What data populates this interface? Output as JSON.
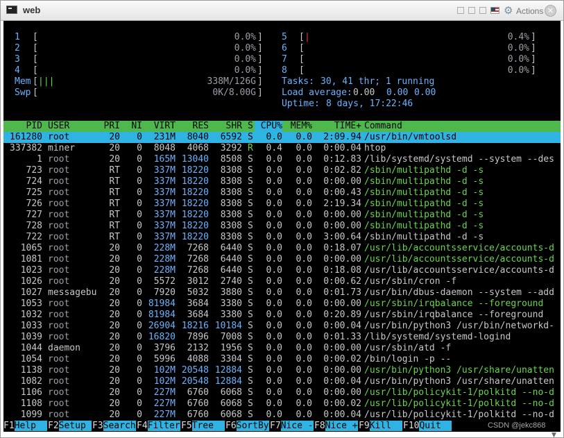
{
  "window": {
    "title": "web",
    "actions_label": "Actions",
    "close_glyph": "✕",
    "icons": [
      "terminal-icon",
      "restore-icon",
      "minimize-icon",
      "maximize-icon",
      "us-flag-icon",
      "gear-icon",
      "close-icon"
    ]
  },
  "meters": {
    "cpus_left": [
      {
        "num": "1",
        "open": "[",
        "bar": "",
        "value": "0.0%",
        "close": "]"
      },
      {
        "num": "2",
        "open": "[",
        "bar": "",
        "value": "0.0%",
        "close": "]"
      },
      {
        "num": "3",
        "open": "[",
        "bar": "",
        "value": "0.0%",
        "close": "]"
      },
      {
        "num": "4",
        "open": "[",
        "bar": "",
        "value": "0.0%",
        "close": "]"
      }
    ],
    "cpus_right": [
      {
        "num": "5",
        "open": "[",
        "bar": "|",
        "value": "0.4%",
        "close": "]"
      },
      {
        "num": "6",
        "open": "[",
        "bar": "",
        "value": "0.0%",
        "close": "]"
      },
      {
        "num": "7",
        "open": "[",
        "bar": "",
        "value": "0.0%",
        "close": "]"
      },
      {
        "num": "8",
        "open": "[",
        "bar": "",
        "value": "0.0%",
        "close": "]"
      }
    ],
    "mem": {
      "label": "Mem",
      "open": "[",
      "bar": "|||",
      "value": "338M/126G",
      "close": "]"
    },
    "swp": {
      "label": "Swp",
      "open": "[",
      "bar": "",
      "value": "0K/8.00G",
      "close": "]"
    },
    "tasks": {
      "label": "Tasks:",
      "value": "30, 41 thr; 1 running"
    },
    "load": {
      "label": "Load average:",
      "v1": "0.00",
      "v2": "0.00",
      "v3": "0.00"
    },
    "uptime": {
      "label": "Uptime:",
      "value": "8 days, 17:22:46"
    }
  },
  "table": {
    "columns": [
      "PID",
      "USER",
      "PRI",
      "NI",
      "VIRT",
      "RES",
      "SHR",
      "S",
      "CPU%",
      "MEM%",
      "TIME+",
      "Command"
    ],
    "rows": [
      {
        "pid": "161280",
        "user": "root",
        "pri": "20",
        "ni": "0",
        "virt": "231M",
        "res": "8040",
        "shr": "6592",
        "s": "S",
        "cpu": "0.0",
        "mem": "0.0",
        "time": "2:09.94",
        "cmd": "/usr/bin/vmtoolsd",
        "thread": false
      },
      {
        "pid": "337382",
        "user": "miner",
        "pri": "20",
        "ni": "0",
        "virt": "8048",
        "res": "4068",
        "shr": "3292",
        "s": "R",
        "cpu": "0.4",
        "mem": "0.0",
        "time": "0:00.04",
        "cmd": "htop",
        "thread": false
      },
      {
        "pid": "1",
        "user": "root",
        "pri": "20",
        "ni": "0",
        "virt": "165M",
        "res": "13040",
        "shr": "8508",
        "s": "S",
        "cpu": "0.0",
        "mem": "0.0",
        "time": "0:12.83",
        "cmd": "/lib/systemd/systemd --system --des",
        "thread": false
      },
      {
        "pid": "723",
        "user": "root",
        "pri": "RT",
        "ni": "0",
        "virt": "337M",
        "res": "18220",
        "shr": "8308",
        "s": "S",
        "cpu": "0.0",
        "mem": "0.0",
        "time": "0:02.82",
        "cmd": "/sbin/multipathd -d -s",
        "thread": true
      },
      {
        "pid": "724",
        "user": "root",
        "pri": "RT",
        "ni": "0",
        "virt": "337M",
        "res": "18220",
        "shr": "8308",
        "s": "S",
        "cpu": "0.0",
        "mem": "0.0",
        "time": "0:00.00",
        "cmd": "/sbin/multipathd -d -s",
        "thread": true
      },
      {
        "pid": "725",
        "user": "root",
        "pri": "RT",
        "ni": "0",
        "virt": "337M",
        "res": "18220",
        "shr": "8308",
        "s": "S",
        "cpu": "0.0",
        "mem": "0.0",
        "time": "0:00.43",
        "cmd": "/sbin/multipathd -d -s",
        "thread": true
      },
      {
        "pid": "726",
        "user": "root",
        "pri": "RT",
        "ni": "0",
        "virt": "337M",
        "res": "18220",
        "shr": "8308",
        "s": "S",
        "cpu": "0.0",
        "mem": "0.0",
        "time": "2:19.34",
        "cmd": "/sbin/multipathd -d -s",
        "thread": true
      },
      {
        "pid": "727",
        "user": "root",
        "pri": "RT",
        "ni": "0",
        "virt": "337M",
        "res": "18220",
        "shr": "8308",
        "s": "S",
        "cpu": "0.0",
        "mem": "0.0",
        "time": "0:00.00",
        "cmd": "/sbin/multipathd -d -s",
        "thread": true
      },
      {
        "pid": "728",
        "user": "root",
        "pri": "RT",
        "ni": "0",
        "virt": "337M",
        "res": "18220",
        "shr": "8308",
        "s": "S",
        "cpu": "0.0",
        "mem": "0.0",
        "time": "0:00.00",
        "cmd": "/sbin/multipathd -d -s",
        "thread": true
      },
      {
        "pid": "722",
        "user": "root",
        "pri": "RT",
        "ni": "0",
        "virt": "337M",
        "res": "18220",
        "shr": "8308",
        "s": "S",
        "cpu": "0.0",
        "mem": "0.0",
        "time": "3:00.64",
        "cmd": "/sbin/multipathd -d -s",
        "thread": false
      },
      {
        "pid": "1065",
        "user": "root",
        "pri": "20",
        "ni": "0",
        "virt": "228M",
        "res": "7268",
        "shr": "6440",
        "s": "S",
        "cpu": "0.0",
        "mem": "0.0",
        "time": "0:18.07",
        "cmd": "/usr/lib/accountsservice/accounts-d",
        "thread": true
      },
      {
        "pid": "1081",
        "user": "root",
        "pri": "20",
        "ni": "0",
        "virt": "228M",
        "res": "7268",
        "shr": "6440",
        "s": "S",
        "cpu": "0.0",
        "mem": "0.0",
        "time": "0:00.00",
        "cmd": "/usr/lib/accountsservice/accounts-d",
        "thread": true
      },
      {
        "pid": "1023",
        "user": "root",
        "pri": "20",
        "ni": "0",
        "virt": "228M",
        "res": "7268",
        "shr": "6440",
        "s": "S",
        "cpu": "0.0",
        "mem": "0.0",
        "time": "0:18.08",
        "cmd": "/usr/lib/accountsservice/accounts-d",
        "thread": false
      },
      {
        "pid": "1026",
        "user": "root",
        "pri": "20",
        "ni": "0",
        "virt": "5572",
        "res": "3012",
        "shr": "2740",
        "s": "S",
        "cpu": "0.0",
        "mem": "0.0",
        "time": "0:00.62",
        "cmd": "/usr/sbin/cron -f",
        "thread": false
      },
      {
        "pid": "1027",
        "user": "messagebu",
        "pri": "20",
        "ni": "0",
        "virt": "7920",
        "res": "5032",
        "shr": "3880",
        "s": "S",
        "cpu": "0.0",
        "mem": "0.0",
        "time": "0:01.73",
        "cmd": "/usr/bin/dbus-daemon --system --add",
        "thread": false
      },
      {
        "pid": "1053",
        "user": "root",
        "pri": "20",
        "ni": "0",
        "virt": "81984",
        "res": "3684",
        "shr": "3380",
        "s": "S",
        "cpu": "0.0",
        "mem": "0.0",
        "time": "0:00.00",
        "cmd": "/usr/sbin/irqbalance --foreground",
        "thread": true
      },
      {
        "pid": "1032",
        "user": "root",
        "pri": "20",
        "ni": "0",
        "virt": "81984",
        "res": "3684",
        "shr": "3380",
        "s": "S",
        "cpu": "0.0",
        "mem": "0.0",
        "time": "0:20.89",
        "cmd": "/usr/sbin/irqbalance --foreground",
        "thread": false
      },
      {
        "pid": "1033",
        "user": "root",
        "pri": "20",
        "ni": "0",
        "virt": "26904",
        "res": "18216",
        "shr": "10184",
        "s": "S",
        "cpu": "0.0",
        "mem": "0.0",
        "time": "0:00.04",
        "cmd": "/usr/bin/python3 /usr/bin/networkd-",
        "thread": false
      },
      {
        "pid": "1039",
        "user": "root",
        "pri": "20",
        "ni": "0",
        "virt": "16820",
        "res": "7896",
        "shr": "7008",
        "s": "S",
        "cpu": "0.0",
        "mem": "0.0",
        "time": "0:01.33",
        "cmd": "/lib/systemd/systemd-logind",
        "thread": false
      },
      {
        "pid": "1044",
        "user": "daemon",
        "pri": "20",
        "ni": "0",
        "virt": "3796",
        "res": "2132",
        "shr": "1956",
        "s": "S",
        "cpu": "0.0",
        "mem": "0.0",
        "time": "0:00.00",
        "cmd": "/usr/sbin/atd -f",
        "thread": false
      },
      {
        "pid": "1054",
        "user": "root",
        "pri": "20",
        "ni": "0",
        "virt": "5996",
        "res": "4088",
        "shr": "3304",
        "s": "S",
        "cpu": "0.0",
        "mem": "0.0",
        "time": "0:00.02",
        "cmd": "/bin/login -p --",
        "thread": false
      },
      {
        "pid": "1138",
        "user": "root",
        "pri": "20",
        "ni": "0",
        "virt": "102M",
        "res": "20548",
        "shr": "12884",
        "s": "S",
        "cpu": "0.0",
        "mem": "0.0",
        "time": "0:00.00",
        "cmd": "/usr/bin/python3 /usr/share/unatten",
        "thread": true
      },
      {
        "pid": "1082",
        "user": "root",
        "pri": "20",
        "ni": "0",
        "virt": "102M",
        "res": "20548",
        "shr": "12884",
        "s": "S",
        "cpu": "0.0",
        "mem": "0.0",
        "time": "0:00.04",
        "cmd": "/usr/bin/python3 /usr/share/unatten",
        "thread": false
      },
      {
        "pid": "1106",
        "user": "root",
        "pri": "20",
        "ni": "0",
        "virt": "227M",
        "res": "6760",
        "shr": "6068",
        "s": "S",
        "cpu": "0.0",
        "mem": "0.0",
        "time": "0:00.00",
        "cmd": "/usr/lib/policykit-1/polkitd --no-d",
        "thread": true
      },
      {
        "pid": "1108",
        "user": "root",
        "pri": "20",
        "ni": "0",
        "virt": "227M",
        "res": "6760",
        "shr": "6068",
        "s": "S",
        "cpu": "0.0",
        "mem": "0.0",
        "time": "0:00.02",
        "cmd": "/usr/lib/policykit-1/polkitd --no-d",
        "thread": true
      },
      {
        "pid": "1099",
        "user": "root",
        "pri": "20",
        "ni": "0",
        "virt": "227M",
        "res": "6760",
        "shr": "6068",
        "s": "S",
        "cpu": "0.0",
        "mem": "0.0",
        "time": "0:00.04",
        "cmd": "/usr/lib/policykit-1/polkitd --no-d",
        "thread": false
      }
    ]
  },
  "fkeys": [
    {
      "key": "F1",
      "label": "Help  "
    },
    {
      "key": "F2",
      "label": "Setup "
    },
    {
      "key": "F3",
      "label": "Search"
    },
    {
      "key": "F4",
      "label": "Filter"
    },
    {
      "key": "F5",
      "label": "Tree  "
    },
    {
      "key": "F6",
      "label": "SortBy"
    },
    {
      "key": "F7",
      "label": "Nice -"
    },
    {
      "key": "F8",
      "label": "Nice +"
    },
    {
      "key": "F9",
      "label": "Kill  "
    },
    {
      "key": "F10",
      "label": "Quit  "
    }
  ],
  "watermark": "CSDN @jekc868",
  "colors": {
    "terminal_bg": "#000000",
    "header_green": "#4fb84d",
    "selection_cyan": "#2fb3e3",
    "thread_green": "#69d64a",
    "number_blue": "#6bb3ff"
  }
}
